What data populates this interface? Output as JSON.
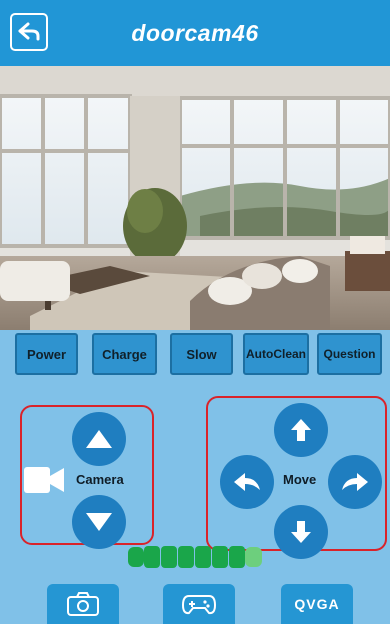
{
  "header": {
    "title": "doorcam46",
    "back_icon": "back-arrow-icon"
  },
  "video": {
    "description_icon": "camera-feed"
  },
  "commands": [
    {
      "label": "Power"
    },
    {
      "label": "Charge"
    },
    {
      "label": "Slow"
    },
    {
      "label": "AutoClean"
    },
    {
      "label": "Question"
    }
  ],
  "camera_control": {
    "label": "Camera",
    "up_icon": "triangle-up-icon",
    "down_icon": "triangle-down-icon",
    "camera_icon": "video-camera-icon"
  },
  "move_control": {
    "label": "Move",
    "up_icon": "arrow-up-icon",
    "down_icon": "arrow-down-icon",
    "left_icon": "turn-left-icon",
    "right_icon": "turn-right-icon"
  },
  "battery": {
    "level": 0.8,
    "color": "#1aa64a"
  },
  "tabs": [
    {
      "name": "snapshot",
      "icon": "camera-icon"
    },
    {
      "name": "gamepad",
      "icon": "gamepad-icon"
    },
    {
      "name": "resolution",
      "label": "QVGA"
    }
  ],
  "colors": {
    "header": "#2196d6",
    "background": "#80c1e8",
    "button": "#2f93cf",
    "control": "#1f7ec0",
    "border_red": "#d9232a"
  }
}
